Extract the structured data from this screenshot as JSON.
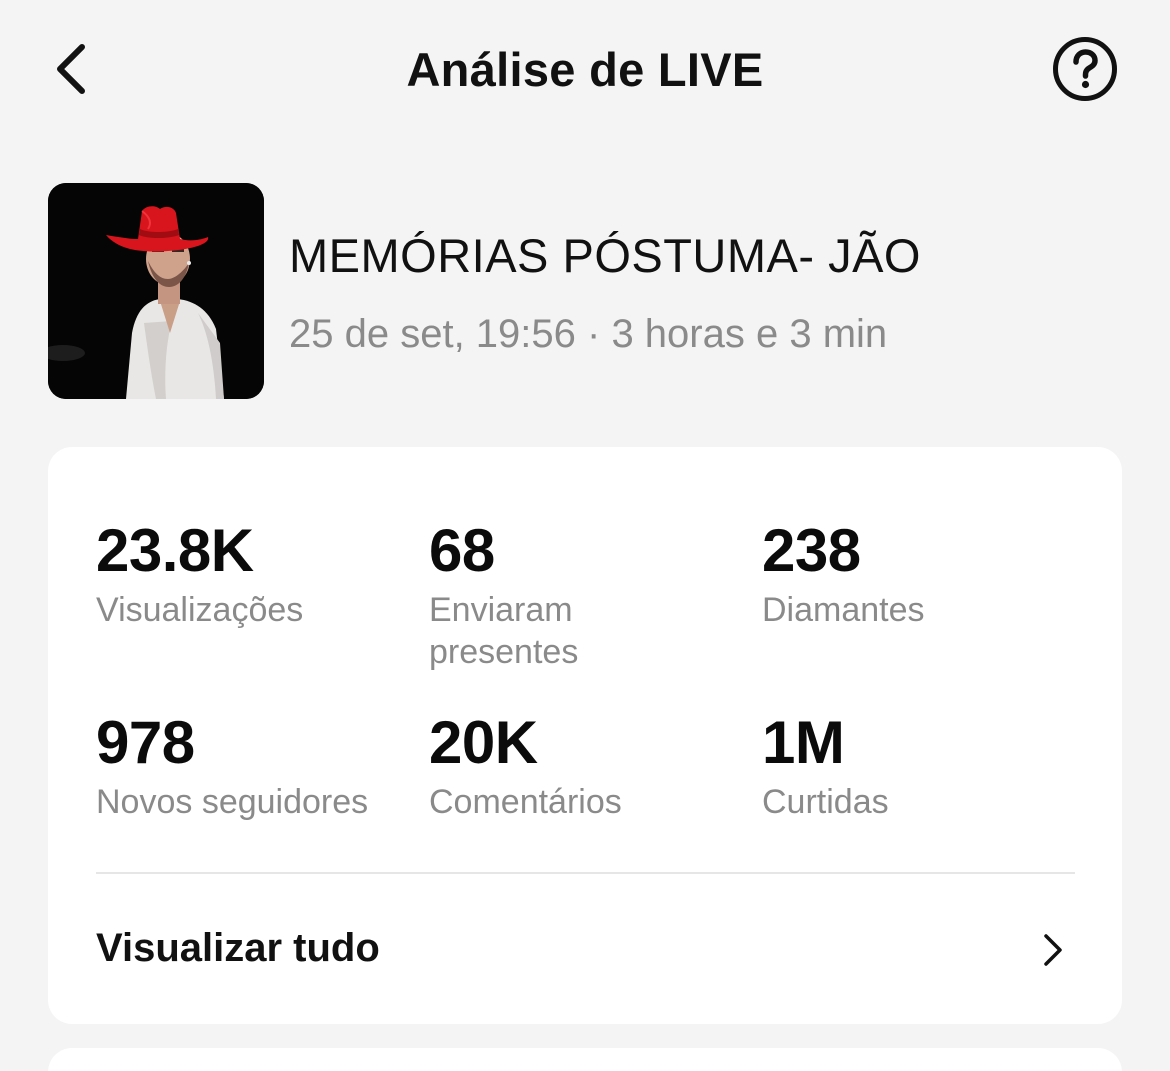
{
  "header": {
    "title": "Análise de LIVE",
    "back_icon": "chevron-left-icon",
    "help_icon": "question-circle-icon"
  },
  "live": {
    "title": "MEMÓRIAS PÓSTUMA- JÃO",
    "meta": "25 de set, 19:56 · 3 horas e 3 min",
    "thumbnail": "performer-red-cowboy-hat-image"
  },
  "stats": [
    {
      "value": "23.8K",
      "label": "Visualizações"
    },
    {
      "value": "68",
      "label": "Enviaram presentes"
    },
    {
      "value": "238",
      "label": "Diamantes"
    },
    {
      "value": "978",
      "label": "Novos seguidores"
    },
    {
      "value": "20K",
      "label": "Comentários"
    },
    {
      "value": "1M",
      "label": "Curtidas"
    }
  ],
  "view_all": {
    "label": "Visualizar tudo",
    "icon": "chevron-right-icon"
  },
  "colors": {
    "background": "#f4f4f4",
    "card": "#ffffff",
    "primary_text": "#111111",
    "secondary_text": "#8a8a8a",
    "hat_red": "#d8141c"
  }
}
